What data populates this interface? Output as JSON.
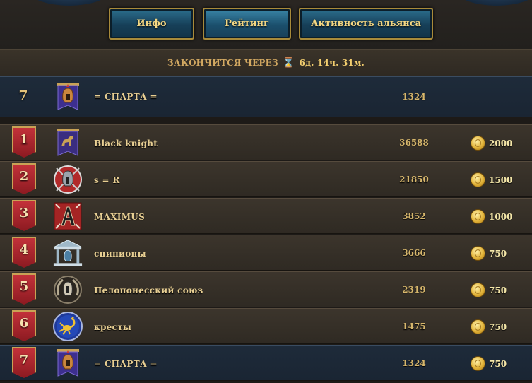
{
  "tabs": [
    {
      "label": "Инфо",
      "active": false
    },
    {
      "label": "Рейтинг",
      "active": true
    },
    {
      "label": "Активность альянса",
      "active": false
    }
  ],
  "timer": {
    "label": "ЗАКОНЧИТСЯ ЧЕРЕЗ",
    "value": "6д. 14ч. 31м.",
    "icon": "hourglass-icon"
  },
  "own": {
    "rank": "7",
    "name": "= СПАРТА =",
    "score": "1324",
    "emblem": "spartan-helmet-banner-icon"
  },
  "rows": [
    {
      "rank": "1",
      "name": "Black knight",
      "score": "36588",
      "reward": "2000",
      "emblem": "horse-banner-icon"
    },
    {
      "rank": "2",
      "name": "s = R",
      "score": "21850",
      "reward": "1500",
      "emblem": "helmet-swords-icon"
    },
    {
      "rank": "3",
      "name": "MAXIMUS",
      "score": "3852",
      "reward": "1000",
      "emblem": "letter-a-icon"
    },
    {
      "rank": "4",
      "name": "сципионы",
      "score": "3666",
      "reward": "750",
      "emblem": "temple-icon"
    },
    {
      "rank": "5",
      "name": "Пелопонесский союз",
      "score": "2319",
      "reward": "750",
      "emblem": "laurel-helmet-icon"
    },
    {
      "rank": "6",
      "name": "кресты",
      "score": "1475",
      "reward": "750",
      "emblem": "scorpion-icon"
    },
    {
      "rank": "7",
      "name": "= СПАРТА =",
      "score": "1324",
      "reward": "750",
      "emblem": "spartan-helmet-banner-icon"
    }
  ],
  "colors": {
    "accent_gold": "#f3d783",
    "tab_blue": "#1b4f6c",
    "rank_red": "#b32a31",
    "highlight_blue": "#1e2b3a"
  }
}
